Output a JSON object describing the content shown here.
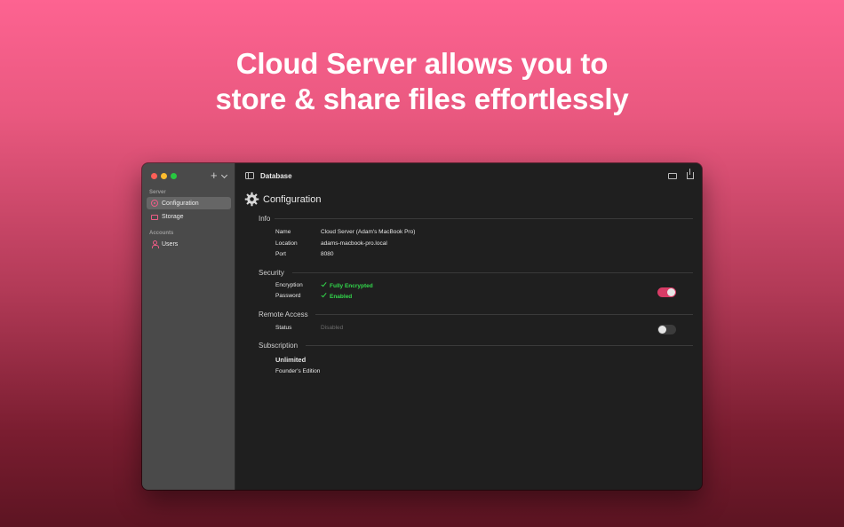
{
  "headline": {
    "line1": "Cloud Server allows you to",
    "line2": "store & share files effortlessly"
  },
  "window": {
    "toolbar_title": "Database",
    "add_label": "+",
    "sidebar": {
      "sections": [
        {
          "label": "Server",
          "items": [
            {
              "label": "Configuration",
              "icon": "gear-icon",
              "active": true
            },
            {
              "label": "Storage",
              "icon": "folder-icon",
              "active": false
            }
          ]
        },
        {
          "label": "Accounts",
          "items": [
            {
              "label": "Users",
              "icon": "user-icon",
              "active": false
            }
          ]
        }
      ]
    },
    "page_title": "Configuration",
    "info": {
      "title": "Info",
      "rows": [
        {
          "label": "Name",
          "value": "Cloud Server (Adam's MacBook Pro)"
        },
        {
          "label": "Location",
          "value": "adams-macbook-pro.local"
        },
        {
          "label": "Port",
          "value": "8080"
        }
      ]
    },
    "security": {
      "title": "Security",
      "encryption_label": "Encryption",
      "encryption_value": "Fully Encrypted",
      "password_label": "Password",
      "password_value": "Enabled",
      "toggle_on": true
    },
    "remote_access": {
      "title": "Remote Access",
      "status_label": "Status",
      "status_value": "Disabled",
      "toggle_on": false
    },
    "subscription": {
      "title": "Subscription",
      "plan": "Unlimited",
      "edition": "Founder's Edition"
    }
  },
  "colors": {
    "accent": "#d83c66",
    "success": "#32d74b",
    "background_top": "#fd6391",
    "background_bottom": "#5d1422"
  }
}
